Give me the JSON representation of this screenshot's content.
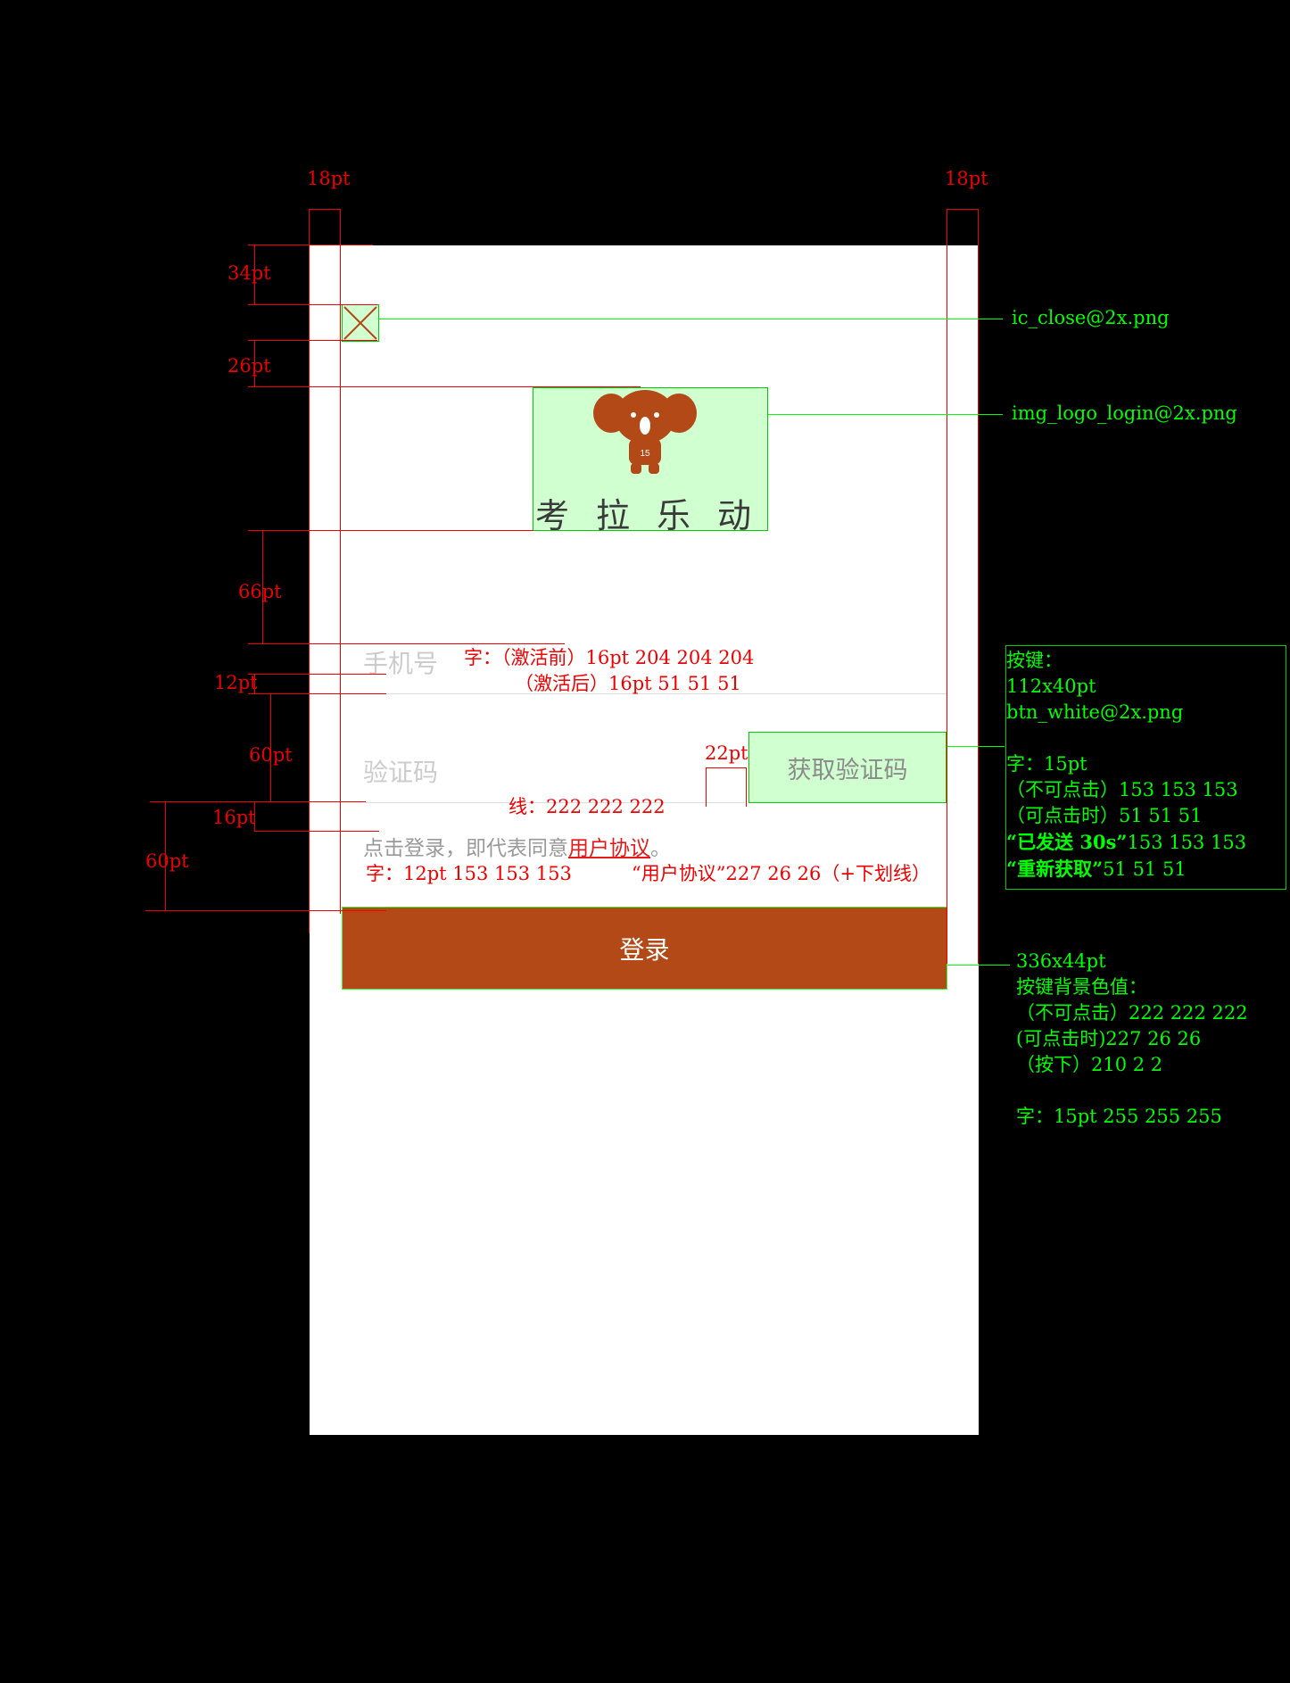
{
  "screen": {
    "logo_text": "考拉乐动",
    "mascot_badge": "15",
    "phone_placeholder": "手机号",
    "code_placeholder": "验证码",
    "get_code_label": "获取验证码",
    "agreement_prefix": "点击登录，即代表同意",
    "agreement_link": "用户协议",
    "agreement_suffix": "。",
    "login_label": "登录"
  },
  "measurements": {
    "left_margin": "18pt",
    "right_margin": "18pt",
    "close_top": "34pt",
    "logo_top": "26pt",
    "phone_top": "66pt",
    "phone_line": "12pt",
    "code_gap": "60pt",
    "button_gap": "22pt",
    "agree_top": "16pt",
    "login_gap": "60pt"
  },
  "annotations": {
    "phone_font_1": "字：（激活前）16pt 204 204 204",
    "phone_font_2": "（激活后）16pt 51 51 51",
    "line_color": "线：222 222 222",
    "agree_font": "字：12pt 153 153 153",
    "agree_link_font": "“用户协议”227 26 26（+下划线）",
    "close_file": "ic_close@2x.png",
    "logo_file": "img_logo_login@2x.png",
    "code_button": {
      "title": "按键：",
      "size": "112x40pt",
      "file": "btn_white@2x.png",
      "font": "字：15pt",
      "disabled": "（不可点击）153 153 153",
      "enabled": "（可点击时）51 51 51",
      "sent_label": "“已发送 30s”",
      "sent_color": "153 153 153",
      "retry_label": "“重新获取”",
      "retry_color": "51 51 51"
    },
    "login_button": {
      "size": "336x44pt",
      "bg_title": "按键背景色值：",
      "disabled": "（不可点击）222 222 222",
      "enabled": "(可点击时)227 26 26",
      "pressed": "（按下）210 2 2",
      "font": "字：15pt  255 255 255"
    }
  },
  "colors": {
    "login_bg": "#b34917",
    "link": "#e31a1a",
    "annotation_red": "#e00",
    "annotation_green": "#00ff00"
  }
}
